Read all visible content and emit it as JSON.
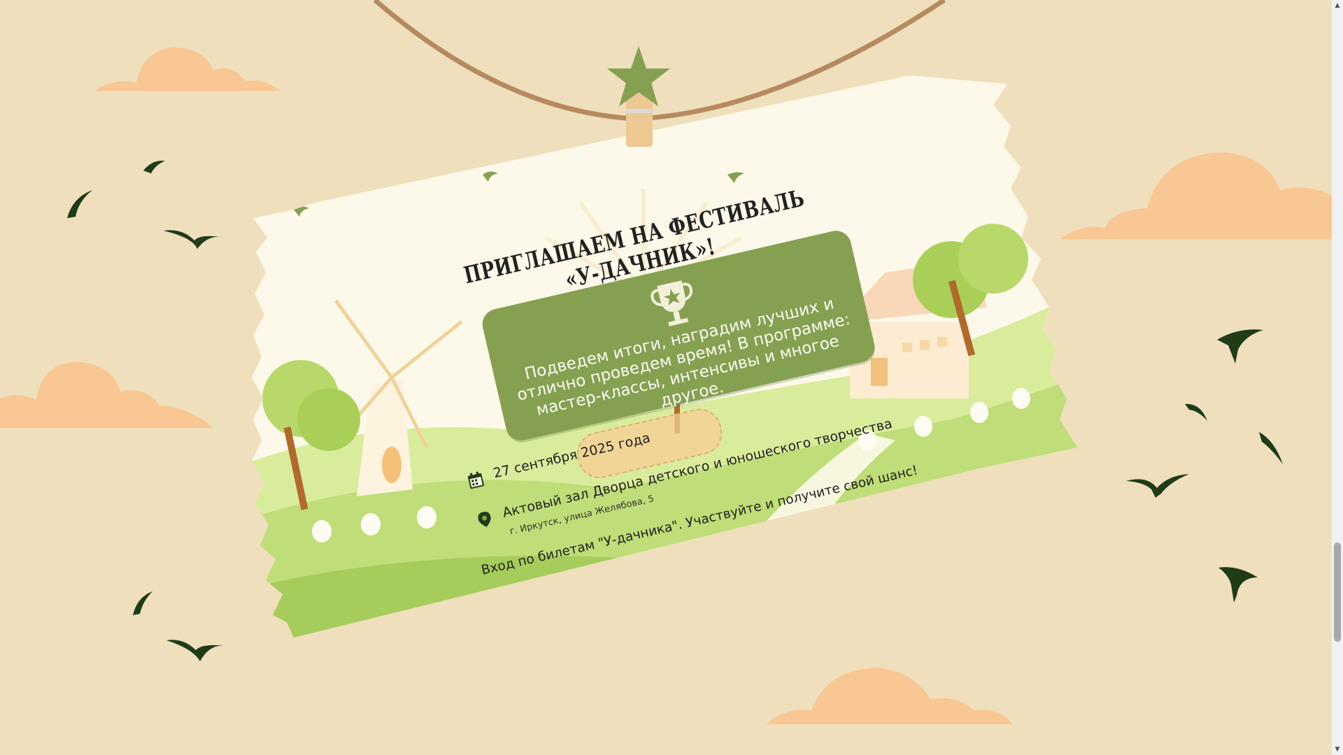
{
  "invitation": {
    "title": "Приглашаем на фестиваль «У-дачник»!",
    "description": "Подведем итоги, наградим лучших и отлично проведем время! В программе: мастер-классы, интенсивы и многое другое.",
    "date": "27 сентября 2025 года",
    "venue": "Актовый зал Дворца детского и юношеского творчества",
    "address": "г. Иркутск, улица Желябова, 5",
    "entry_note": "Вход по билетам \"У-дачника\". Участвуйте и получите свой шанс!"
  },
  "icons": {
    "calendar": "calendar-icon",
    "location": "location-pin-icon",
    "trophy": "trophy-icon",
    "star_clip": "star-icon"
  },
  "colors": {
    "background": "#efdfbc",
    "accent_green": "#86a052",
    "cloud": "#f8c793",
    "bird": "#1f3b17",
    "rope": "#b68a5f",
    "card": "#fdf9ea"
  }
}
